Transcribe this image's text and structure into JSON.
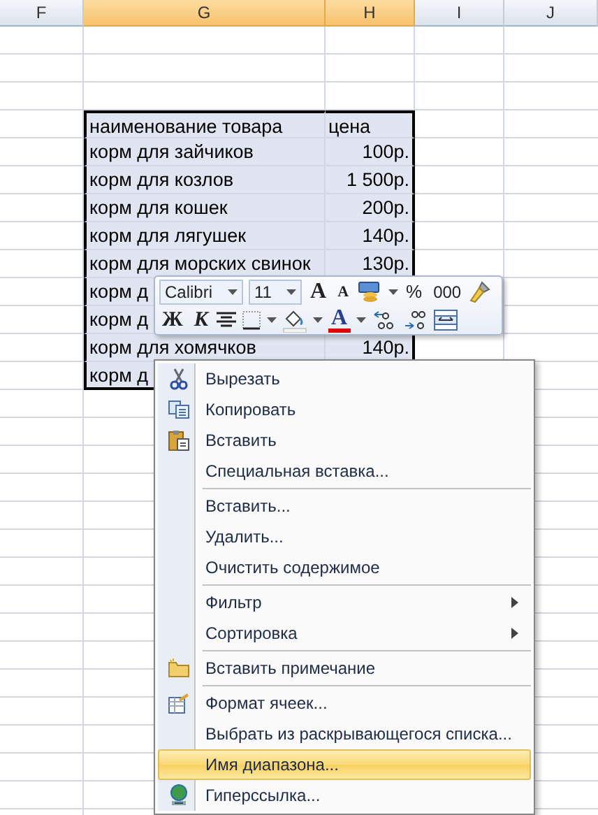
{
  "column_headers": [
    {
      "label": "F",
      "selected": false
    },
    {
      "label": "G",
      "selected": true
    },
    {
      "label": "H",
      "selected": true
    },
    {
      "label": "I",
      "selected": false
    },
    {
      "label": "J",
      "selected": false
    }
  ],
  "table": {
    "rows": [
      {
        "name": "наименование товара",
        "price": "цена",
        "kind": "header"
      },
      {
        "name": "корм для зайчиков",
        "price": "100р.",
        "kind": "data"
      },
      {
        "name": "корм для козлов",
        "price": "1 500р.",
        "kind": "data"
      },
      {
        "name": "корм для кошек",
        "price": "200р.",
        "kind": "data"
      },
      {
        "name": "корм для лягушек",
        "price": "140р.",
        "kind": "data"
      },
      {
        "name": "корм для морских свинок",
        "price": "130р.",
        "kind": "data"
      },
      {
        "name": "корм д",
        "kind": "data"
      },
      {
        "name": "корм д",
        "kind": "data"
      },
      {
        "name": "корм для хомячков",
        "price": "140р.",
        "kind": "data"
      },
      {
        "name": "корм д",
        "kind": "data"
      }
    ]
  },
  "mini_toolbar": {
    "font": "Calibri",
    "size": "11",
    "grow_font": "A",
    "shrink_font": "A",
    "percent": "%",
    "thousands": "000",
    "bold": "Ж",
    "italic": "К",
    "font_color": "A"
  },
  "context_menu": {
    "groups": [
      [
        {
          "label": "Вырезать",
          "kind": "cut",
          "submenu": false,
          "selected": false
        },
        {
          "label": "Копировать",
          "kind": "copy",
          "submenu": false,
          "selected": false
        },
        {
          "label": "Вставить",
          "kind": "paste",
          "submenu": false,
          "selected": false
        },
        {
          "label": "Специальная вставка...",
          "kind": "plain",
          "submenu": false,
          "selected": false
        }
      ],
      [
        {
          "label": "Вставить...",
          "kind": "plain",
          "submenu": false,
          "selected": false
        },
        {
          "label": "Удалить...",
          "kind": "plain",
          "submenu": false,
          "selected": false
        },
        {
          "label": "Очистить содержимое",
          "kind": "plain",
          "submenu": false,
          "selected": false
        }
      ],
      [
        {
          "label": "Фильтр",
          "kind": "plain",
          "submenu": true,
          "selected": false
        },
        {
          "label": "Сортировка",
          "kind": "plain",
          "submenu": true,
          "selected": false
        }
      ],
      [
        {
          "label": "Вставить примечание",
          "kind": "comment",
          "submenu": false,
          "selected": false
        }
      ],
      [
        {
          "label": "Формат ячеек...",
          "kind": "format",
          "submenu": false,
          "selected": false
        },
        {
          "label": "Выбрать из раскрывающегося списка...",
          "kind": "plain",
          "submenu": false,
          "selected": false
        },
        {
          "label": "Имя диапазона...",
          "kind": "plain",
          "submenu": false,
          "selected": true
        },
        {
          "label": "Гиперссылка...",
          "kind": "link",
          "submenu": false,
          "selected": false
        }
      ]
    ]
  }
}
